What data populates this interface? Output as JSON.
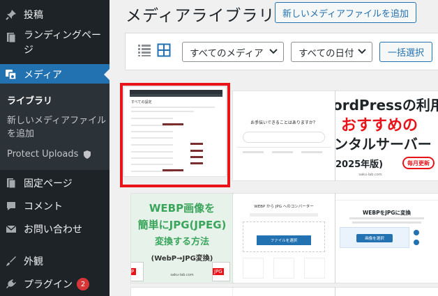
{
  "sidebar": {
    "items": [
      {
        "id": "posts",
        "label": "投稿",
        "icon": "pushpin-icon"
      },
      {
        "id": "landing",
        "label": "ランディングペー\nジ",
        "icon": "pages-icon"
      },
      {
        "id": "media",
        "label": "メディア",
        "icon": "media-icon",
        "active": true
      },
      {
        "id": "fixed-page",
        "label": "固定ページ",
        "icon": "page-icon"
      },
      {
        "id": "comments",
        "label": "コメント",
        "icon": "comment-icon"
      },
      {
        "id": "contact",
        "label": "お問い合わせ",
        "icon": "mail-icon"
      },
      {
        "id": "appearance",
        "label": "外観",
        "icon": "brush-icon"
      },
      {
        "id": "plugins",
        "label": "プラグイン",
        "icon": "plug-icon",
        "badge": "2"
      }
    ],
    "submenu": [
      {
        "label": "ライブラリ",
        "current": true
      },
      {
        "label": "新しいメディアファイル\nを追加"
      },
      {
        "label": "Protect Uploads",
        "icon": "shield-icon"
      }
    ]
  },
  "header": {
    "title": "メディアライブラリ",
    "add_button": "新しいメディアファイルを追加"
  },
  "toolbar": {
    "list_view": "list-view-icon",
    "grid_view": "grid-view-icon",
    "media_filter": "すべてのメディア",
    "date_filter": "すべての日付",
    "bulk_select": "一括選択"
  },
  "thumbs": {
    "t1": {
      "heading": "すべての設定"
    },
    "t2": {
      "question": "お手伝いできることはありますか？"
    },
    "t3": {
      "line1": "ordPressの利用",
      "line2": "おすすめの",
      "line3": "ンタルサーバー",
      "line4": "2025年版)",
      "badge": "毎月更新",
      "footer": "saku-lab.com"
    },
    "t4": {
      "line1": "WEBP画像を",
      "line2": "簡単にJPG(JPEG)",
      "line3": "変換する方法",
      "line4": "(WebP→JPG変換)",
      "file1": "P",
      "file2": "JPG",
      "footer": "saku-lab.com"
    },
    "t5": {
      "heading": "WEBP から JPG へのコンバーター",
      "button": "ファイルを選択"
    },
    "t6": {
      "heading": "WEBPをJPGに変換",
      "button": "画像を選択"
    }
  },
  "colors": {
    "sidebar": "#1d2327",
    "accent": "#2271b1",
    "highlight": "#e8141a"
  }
}
